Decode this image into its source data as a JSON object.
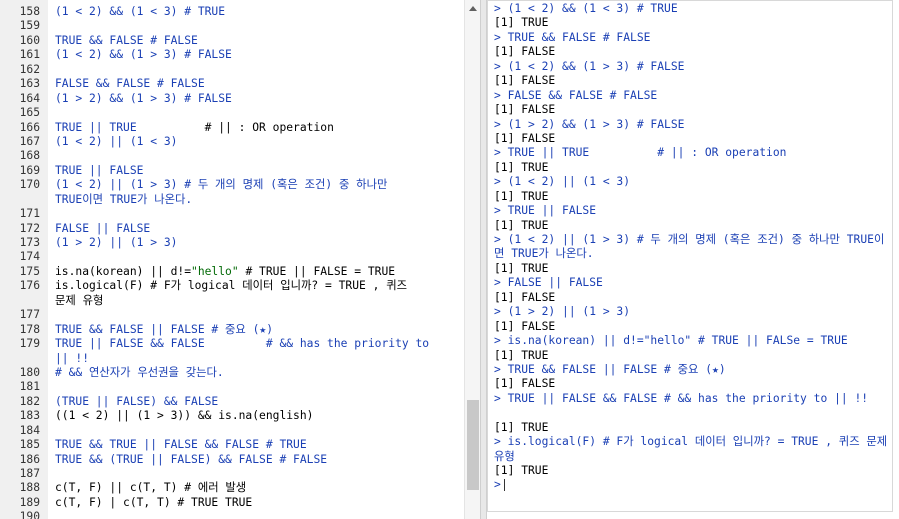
{
  "editor": {
    "lines": [
      {
        "n": "158",
        "parts": [
          [
            "kw",
            "(1 < 2) && (1 < 3) # TRUE"
          ]
        ]
      },
      {
        "n": "159",
        "parts": []
      },
      {
        "n": "160",
        "parts": [
          [
            "kw",
            "TRUE && FALSE # FALSE"
          ]
        ]
      },
      {
        "n": "161",
        "parts": [
          [
            "kw",
            "(1 < 2) && (1 > 3) # FALSE"
          ]
        ]
      },
      {
        "n": "162",
        "parts": []
      },
      {
        "n": "163",
        "parts": [
          [
            "kw",
            "FALSE && FALSE # FALSE"
          ]
        ]
      },
      {
        "n": "164",
        "parts": [
          [
            "kw",
            "(1 > 2) && (1 > 3) # FALSE"
          ]
        ]
      },
      {
        "n": "165",
        "parts": []
      },
      {
        "n": "166",
        "parts": [
          [
            "kw",
            "TRUE || TRUE          "
          ],
          [
            "txt",
            "# || : OR operation"
          ]
        ]
      },
      {
        "n": "167",
        "parts": [
          [
            "kw",
            "(1 < 2) || (1 < 3)"
          ]
        ]
      },
      {
        "n": "168",
        "parts": []
      },
      {
        "n": "169",
        "parts": [
          [
            "kw",
            "TRUE || FALSE"
          ]
        ]
      },
      {
        "n": "170",
        "wrap": true,
        "parts": [
          [
            "kw",
            "(1 < 2) || (1 > 3) # 두 개의 명제 (혹은 조건) 중 하나만\nTRUE이면 TRUE가 나온다."
          ]
        ]
      },
      {
        "n": "171",
        "parts": []
      },
      {
        "n": "172",
        "parts": [
          [
            "kw",
            "FALSE || FALSE"
          ]
        ]
      },
      {
        "n": "173",
        "parts": [
          [
            "kw",
            "(1 > 2) || (1 > 3)"
          ]
        ]
      },
      {
        "n": "174",
        "parts": []
      },
      {
        "n": "175",
        "parts": [
          [
            "txt",
            "is.na(korean) || d!="
          ],
          [
            "str",
            "\"hello\""
          ],
          [
            "txt",
            " # TRUE || FALSE = TRUE"
          ]
        ]
      },
      {
        "n": "176",
        "wrap": true,
        "parts": [
          [
            "txt",
            "is.logical(F) # F가 logical 데이터 입니까? = TRUE , 퀴즈\n문제 유형"
          ]
        ]
      },
      {
        "n": "177",
        "parts": []
      },
      {
        "n": "178",
        "parts": [
          [
            "kw",
            "TRUE && FALSE || FALSE # 중요 (★)"
          ]
        ]
      },
      {
        "n": "179",
        "wrap": true,
        "parts": [
          [
            "kw",
            "TRUE || FALSE && FALSE         # && has the priority to\n|| !!"
          ]
        ]
      },
      {
        "n": "180",
        "parts": [
          [
            "kw",
            "# && 연산자가 우선권을 갖는다."
          ]
        ]
      },
      {
        "n": "181",
        "parts": []
      },
      {
        "n": "182",
        "parts": [
          [
            "kw",
            "(TRUE || FALSE) && FALSE"
          ]
        ]
      },
      {
        "n": "183",
        "parts": [
          [
            "txt",
            "((1 < 2) || (1 > 3)) && is.na(english)"
          ]
        ]
      },
      {
        "n": "184",
        "parts": []
      },
      {
        "n": "185",
        "parts": [
          [
            "kw",
            "TRUE && TRUE || FALSE && FALSE # TRUE"
          ]
        ]
      },
      {
        "n": "186",
        "parts": [
          [
            "kw",
            "TRUE && (TRUE || FALSE) && FALSE # FALSE"
          ]
        ]
      },
      {
        "n": "187",
        "parts": []
      },
      {
        "n": "188",
        "parts": [
          [
            "txt",
            "c(T, F) || c(T, T) # 에러 발생"
          ]
        ]
      },
      {
        "n": "189",
        "parts": [
          [
            "txt",
            "c(T, F) | c(T, T) # TRUE TRUE"
          ]
        ]
      },
      {
        "n": "190",
        "parts": []
      }
    ]
  },
  "console": {
    "lines": [
      {
        "t": "in",
        "text": "> (1 < 2) && (1 < 3) # TRUE"
      },
      {
        "t": "out",
        "text": "[1] TRUE"
      },
      {
        "t": "in",
        "text": "> TRUE && FALSE # FALSE"
      },
      {
        "t": "out",
        "text": "[1] FALSE"
      },
      {
        "t": "in",
        "text": "> (1 < 2) && (1 > 3) # FALSE"
      },
      {
        "t": "out",
        "text": "[1] FALSE"
      },
      {
        "t": "in",
        "text": "> FALSE && FALSE # FALSE"
      },
      {
        "t": "out",
        "text": "[1] FALSE"
      },
      {
        "t": "in",
        "text": "> (1 > 2) && (1 > 3) # FALSE"
      },
      {
        "t": "out",
        "text": "[1] FALSE"
      },
      {
        "t": "in",
        "text": "> TRUE || TRUE          # || : OR operation"
      },
      {
        "t": "out",
        "text": "[1] TRUE"
      },
      {
        "t": "in",
        "text": "> (1 < 2) || (1 < 3)"
      },
      {
        "t": "out",
        "text": "[1] TRUE"
      },
      {
        "t": "in",
        "text": "> TRUE || FALSE"
      },
      {
        "t": "out",
        "text": "[1] TRUE"
      },
      {
        "t": "in",
        "wrap": true,
        "text": "> (1 < 2) || (1 > 3) # 두 개의 명제 (혹은 조건) 중 하나만 TRUE이면 TRUE가 나온다."
      },
      {
        "t": "out",
        "text": "[1] TRUE"
      },
      {
        "t": "in",
        "text": "> FALSE || FALSE"
      },
      {
        "t": "out",
        "text": "[1] FALSE"
      },
      {
        "t": "in",
        "text": "> (1 > 2) || (1 > 3)"
      },
      {
        "t": "out",
        "text": "[1] FALSE"
      },
      {
        "t": "in",
        "text": "> is.na(korean) || d!=\"hello\" # TRUE || FALSe = TRUE"
      },
      {
        "t": "out",
        "text": "[1] TRUE"
      },
      {
        "t": "in",
        "text": "> TRUE && FALSE || FALSE # 중요 (★)"
      },
      {
        "t": "out",
        "text": "[1] FALSE"
      },
      {
        "t": "in",
        "wrap": true,
        "text": "> TRUE || FALSE && FALSE         # && has the priority to || !!"
      },
      {
        "t": "out",
        "text": "[1] TRUE"
      },
      {
        "t": "in",
        "wrap": true,
        "text": "> is.logical(F) # F가 logical 데이터 입니까? = TRUE , 퀴즈 문제 유형"
      },
      {
        "t": "out",
        "text": "[1] TRUE"
      }
    ],
    "prompt": ">"
  },
  "colors": {
    "keyword": "#1a3fb4",
    "comment": "#3c763d",
    "string": "#036a07"
  }
}
